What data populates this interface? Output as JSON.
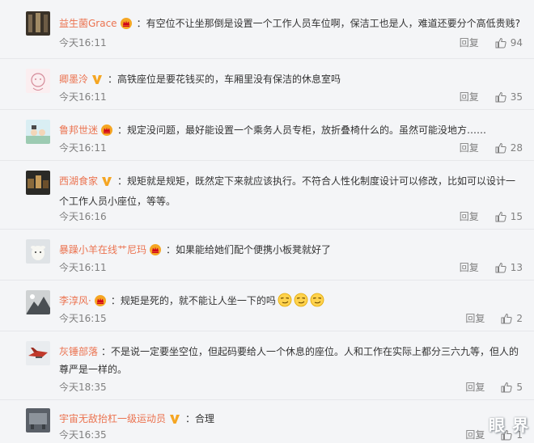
{
  "labels": {
    "reply": "回复"
  },
  "comments": [
    {
      "user": "益生菌Grace",
      "badge": "crown",
      "text": "有空位不让坐那倒是设置一个工作人员车位啊，保洁工也是人，难道还要分个高低贵贱?",
      "time": "今天16:11",
      "likes": "94"
    },
    {
      "user": "卿墨泠",
      "badge": "vip",
      "text": "高铁座位是要花钱买的，车厢里没有保洁的休息室吗",
      "time": "今天16:11",
      "likes": "35"
    },
    {
      "user": "鲁邦世迷",
      "badge": "crown",
      "text": "规定没问题，最好能设置一个乘务人员专柜，放折叠椅什么的。虽然可能没地方……",
      "time": "今天16:11",
      "likes": "28"
    },
    {
      "user": "西湖食家",
      "badge": "vip",
      "text": "规矩就是规矩，既然定下来就应该执行。不符合人性化制度设计可以修改，比如可以设计一个工作人员小座位，等等。",
      "time": "今天16:16",
      "likes": "15"
    },
    {
      "user": "暴躁小羊在线艹尼玛",
      "badge": "crown",
      "text": "如果能给她们配个便携小板凳就好了",
      "time": "今天16:11",
      "likes": "13"
    },
    {
      "user": "李淳风·",
      "badge": "crown",
      "text": "规矩是死的，就不能让人坐一下的吗",
      "time": "今天16:15",
      "likes": "2"
    },
    {
      "user": "灰锤部落",
      "badge": "",
      "text": "不是说一定要坐空位，但起码要给人一个休息的座位。人和工作在实际上都分三六九等，但人的尊严是一样的。",
      "time": "今天18:35",
      "likes": "5"
    },
    {
      "user": "宇宙无敌抬杠一级运动员",
      "badge": "vip",
      "text": "合理",
      "time": "今天16:35",
      "likes": "1"
    }
  ],
  "watermark": "眼 界"
}
